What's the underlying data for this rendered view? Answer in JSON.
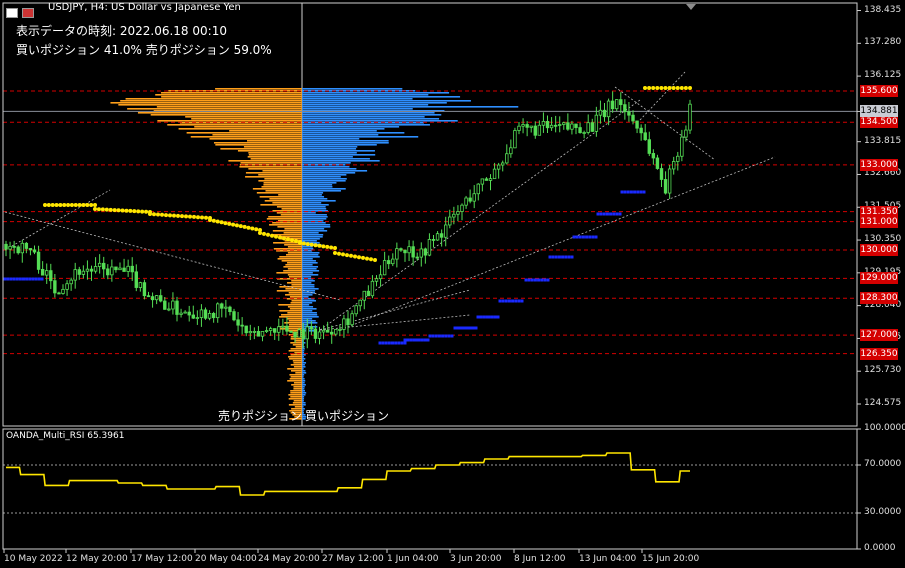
{
  "header": {
    "title": "USDJPY, H4:  US Dollar vs Japanese Yen",
    "info_line1": "表示データの時刻: 2022.06.18 00:10",
    "info_line2": "買いポジション 41.0% 売りポジション 59.0%"
  },
  "profile_labels": {
    "sell": "売りポジション",
    "buy": "買いポジション"
  },
  "rsi": {
    "title": "OANDA_Multi_RSI 65.3961"
  },
  "colors": {
    "background": "#000000",
    "candle": "#55dd55",
    "sell_profile": "#ff9f1a",
    "buy_profile": "#2e8fff",
    "level_line": "#d40000",
    "yellow_dots": "#ffe600",
    "blue_dots": "#1a2aff",
    "rsi_line": "#ffe600",
    "current_price_line": "#8a8f9a"
  },
  "chart_data": {
    "type": "line",
    "symbol": "USDJPY",
    "timeframe": "H4",
    "price_axis": {
      "ylim": [
        123.8,
        138.7
      ],
      "ticks": [
        "138.435",
        "137.280",
        "136.125",
        "134.881",
        "133.815",
        "132.660",
        "131.505",
        "130.350",
        "129.195",
        "128.040",
        "126.885",
        "125.730",
        "124.575"
      ]
    },
    "current_price": "134.881",
    "horizontal_levels": [
      135.6,
      134.5,
      133.0,
      131.35,
      131.0,
      130.0,
      129.0,
      128.3,
      127.0,
      126.35
    ],
    "level_tags": [
      "135.600",
      "134.500",
      "133.000",
      "131.350",
      "131.000",
      "130.000",
      "129.000",
      "128.300",
      "127.000",
      "126.350"
    ],
    "price_close_series": [
      {
        "date": "2022-05-10",
        "value": 130.2
      },
      {
        "date": "2022-05-11",
        "value": 130.0
      },
      {
        "date": "2022-05-12",
        "value": 128.6
      },
      {
        "date": "2022-05-13",
        "value": 129.3
      },
      {
        "date": "2022-05-16",
        "value": 129.3
      },
      {
        "date": "2022-05-17",
        "value": 129.2
      },
      {
        "date": "2022-05-18",
        "value": 128.3
      },
      {
        "date": "2022-05-19",
        "value": 127.9
      },
      {
        "date": "2022-05-20",
        "value": 127.8
      },
      {
        "date": "2022-05-23",
        "value": 127.9
      },
      {
        "date": "2022-05-24",
        "value": 126.9
      },
      {
        "date": "2022-05-25",
        "value": 127.3
      },
      {
        "date": "2022-05-26",
        "value": 127.1
      },
      {
        "date": "2022-05-27",
        "value": 127.1
      },
      {
        "date": "2022-05-30",
        "value": 127.6
      },
      {
        "date": "2022-05-31",
        "value": 128.7
      },
      {
        "date": "2022-06-01",
        "value": 130.1
      },
      {
        "date": "2022-06-02",
        "value": 129.9
      },
      {
        "date": "2022-06-03",
        "value": 130.8
      },
      {
        "date": "2022-06-06",
        "value": 131.9
      },
      {
        "date": "2022-06-07",
        "value": 132.8
      },
      {
        "date": "2022-06-08",
        "value": 134.2
      },
      {
        "date": "2022-06-09",
        "value": 134.3
      },
      {
        "date": "2022-06-10",
        "value": 134.3
      },
      {
        "date": "2022-06-13",
        "value": 134.4
      },
      {
        "date": "2022-06-14",
        "value": 135.3
      },
      {
        "date": "2022-06-15",
        "value": 134.2
      },
      {
        "date": "2022-06-16",
        "value": 132.2
      },
      {
        "date": "2022-06-17",
        "value": 134.9
      }
    ],
    "x_tick_labels": [
      "10 May 2022",
      "12 May 20:00",
      "17 May 12:00",
      "20 May 04:00",
      "24 May 20:00",
      "27 May 12:00",
      "1 Jun 04:00",
      "3 Jun 20:00",
      "8 Jun 12:00",
      "13 Jun 04:00",
      "15 Jun 20:00"
    ],
    "rsi_panel": {
      "ylim": [
        0,
        100
      ],
      "ticks": [
        "100.0000",
        "70.0000",
        "30.0000",
        "0.0000"
      ],
      "dotted_levels": [
        70,
        30
      ],
      "series": [
        {
          "date": "2022-05-10",
          "value": 68
        },
        {
          "date": "2022-05-11",
          "value": 62
        },
        {
          "date": "2022-05-12",
          "value": 53
        },
        {
          "date": "2022-05-13",
          "value": 57
        },
        {
          "date": "2022-05-16",
          "value": 57
        },
        {
          "date": "2022-05-17",
          "value": 55
        },
        {
          "date": "2022-05-18",
          "value": 53
        },
        {
          "date": "2022-05-19",
          "value": 50
        },
        {
          "date": "2022-05-20",
          "value": 50
        },
        {
          "date": "2022-05-23",
          "value": 52
        },
        {
          "date": "2022-05-24",
          "value": 45
        },
        {
          "date": "2022-05-25",
          "value": 48
        },
        {
          "date": "2022-05-26",
          "value": 48
        },
        {
          "date": "2022-05-27",
          "value": 48
        },
        {
          "date": "2022-05-30",
          "value": 51
        },
        {
          "date": "2022-05-31",
          "value": 58
        },
        {
          "date": "2022-06-01",
          "value": 65
        },
        {
          "date": "2022-06-02",
          "value": 67
        },
        {
          "date": "2022-06-03",
          "value": 70
        },
        {
          "date": "2022-06-06",
          "value": 72
        },
        {
          "date": "2022-06-07",
          "value": 75
        },
        {
          "date": "2022-06-08",
          "value": 77
        },
        {
          "date": "2022-06-09",
          "value": 77
        },
        {
          "date": "2022-06-10",
          "value": 77
        },
        {
          "date": "2022-06-13",
          "value": 78
        },
        {
          "date": "2022-06-14",
          "value": 80
        },
        {
          "date": "2022-06-15",
          "value": 66
        },
        {
          "date": "2022-06-16",
          "value": 56
        },
        {
          "date": "2022-06-17",
          "value": 65
        }
      ]
    }
  }
}
